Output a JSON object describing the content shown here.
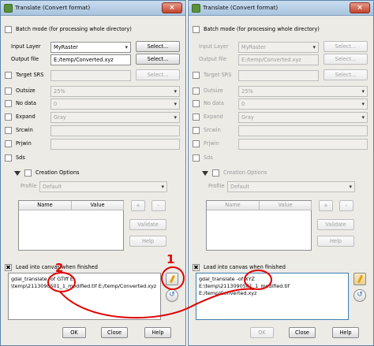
{
  "left": {
    "title": "Translate (Convert format)",
    "batch_mode": "Batch mode (for processing whole directory)",
    "input_layer_label": "Input Layer",
    "input_layer_value": "MyRaster",
    "output_file_label": "Output file",
    "output_file_value": "E:/temp/Converted.xyz",
    "select_label": "Select...",
    "target_srs_label": "Target SRS",
    "outsize_label": "Outsize",
    "outsize_value": "25%",
    "nodata_label": "No data",
    "nodata_value": "0",
    "expand_label": "Expand",
    "expand_value": "Gray",
    "srcwin_label": "Srcwin",
    "prjwin_label": "Prjwin",
    "sds_label": "Sds",
    "creation_options_label": "Creation Options",
    "profile_label": "Profile",
    "profile_value": "Default",
    "name_header": "Name",
    "value_header": "Value",
    "add_label": "+",
    "remove_label": "-",
    "validate_label": "Validate",
    "help_small_label": "Help",
    "load_canvas_label": "Load into canvas when finished",
    "command_line1_a": "gdal_translate -of ",
    "command_line1_b": "GTiff E:",
    "command_line2": "\\temp\\2113090501_1_modified.tif E:/temp/Converted.xyz",
    "ok_label": "OK",
    "close_label": "Close",
    "help_label": "Help"
  },
  "right": {
    "title": "Translate (Convert format)",
    "batch_mode": "Batch mode (for processing whole directory)",
    "input_layer_label": "Input Layer",
    "input_layer_value": "MyRaster",
    "output_file_label": "Output file",
    "output_file_value": "E:/temp/Converted.xyz",
    "select_label": "Select...",
    "target_srs_label": "Target SRS",
    "outsize_label": "Outsize",
    "outsize_value": "25%",
    "nodata_label": "No data",
    "nodata_value": "0",
    "expand_label": "Expand",
    "expand_value": "Gray",
    "srcwin_label": "Srcwin",
    "prjwin_label": "Prjwin",
    "sds_label": "Sds",
    "creation_options_label": "Creation Options",
    "profile_label": "Profile",
    "profile_value": "Default",
    "name_header": "Name",
    "value_header": "Value",
    "add_label": "+",
    "remove_label": "-",
    "validate_label": "Validate",
    "help_small_label": "Help",
    "load_canvas_label": "Load into canvas when finished",
    "command_line1": "gdal_translate -of XYZ E:\\temp\\2113090501_1_modified.tif",
    "command_line2": "E:/temp/Converted.xyz",
    "ok_label": "OK",
    "close_label": "Close",
    "help_label": "Help"
  },
  "annotations": {
    "marker_1": "1",
    "marker_2": "2"
  },
  "colors": {
    "annotation_red": "#e00000",
    "title_bar": "#b7cfe6",
    "selection_blue": "#3399ff"
  }
}
